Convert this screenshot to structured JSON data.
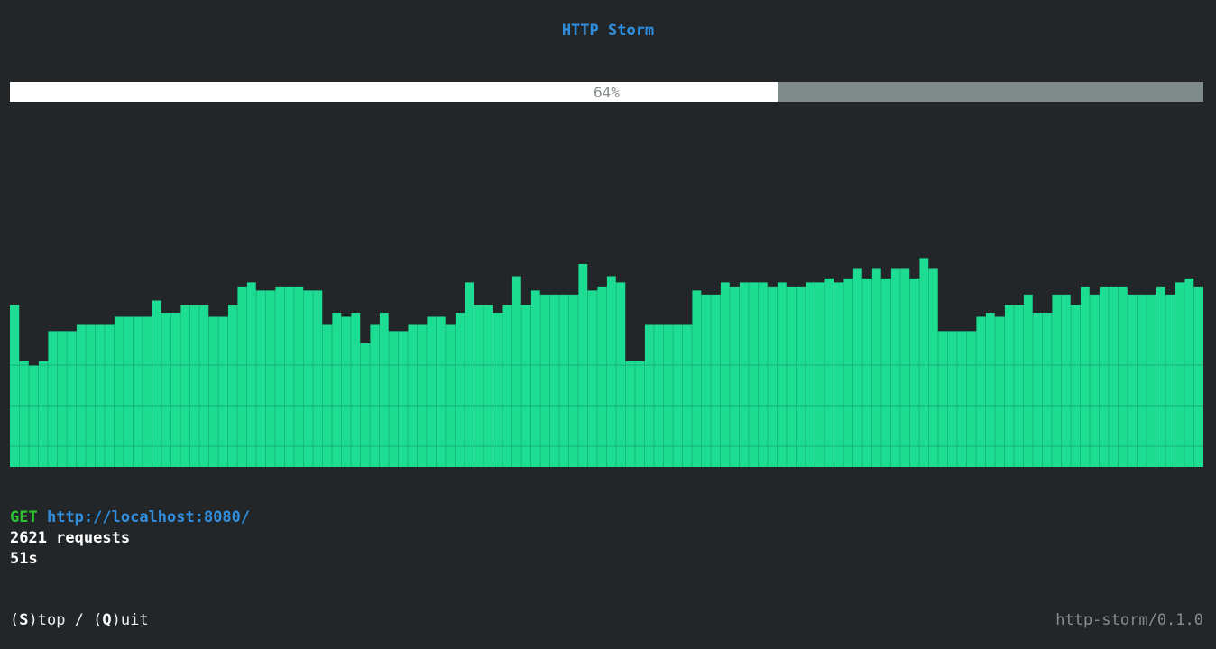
{
  "header": {
    "title": "HTTP Storm"
  },
  "progress": {
    "label": "64%",
    "fraction": 0.643
  },
  "chart_data": {
    "type": "bar",
    "title": "",
    "xlabel": "",
    "ylabel": "",
    "ylim": [
      0,
      100
    ],
    "grid": true,
    "values": [
      80,
      52,
      50,
      52,
      67,
      67,
      67,
      70,
      70,
      70,
      70,
      74,
      74,
      74,
      74,
      82,
      76,
      76,
      80,
      80,
      80,
      74,
      74,
      80,
      89,
      91,
      87,
      87,
      89,
      89,
      89,
      87,
      87,
      70,
      76,
      74,
      76,
      61,
      70,
      76,
      67,
      67,
      70,
      70,
      74,
      74,
      70,
      76,
      91,
      80,
      80,
      76,
      80,
      94,
      80,
      87,
      85,
      85,
      85,
      85,
      100,
      87,
      89,
      94,
      91,
      52,
      52,
      70,
      70,
      70,
      70,
      70,
      87,
      85,
      85,
      91,
      89,
      91,
      91,
      91,
      89,
      91,
      89,
      89,
      91,
      91,
      93,
      91,
      93,
      98,
      93,
      98,
      93,
      98,
      98,
      93,
      103,
      98,
      67,
      67,
      67,
      67,
      74,
      76,
      74,
      80,
      80,
      85,
      76,
      76,
      85,
      85,
      80,
      89,
      85,
      89,
      89,
      89,
      85,
      85,
      85,
      89,
      85,
      91,
      93,
      89
    ],
    "colors": {
      "bar": "#1ddd93",
      "grid": "#16a070"
    }
  },
  "request": {
    "method": "GET",
    "url": "http://localhost:8080/",
    "requests": "2621 requests",
    "elapsed": "51s"
  },
  "footer": {
    "stop_open": "(",
    "stop_key": "S",
    "stop_rest": ")top / (",
    "quit_key": "Q",
    "quit_rest": ")uit",
    "version": "http-storm/0.1.0"
  },
  "colors": {
    "background": "#232628",
    "accent": "#2f8fe0",
    "method": "#2ec12e",
    "progress_fill": "#ffffff",
    "progress_track": "#7f8b8a"
  }
}
